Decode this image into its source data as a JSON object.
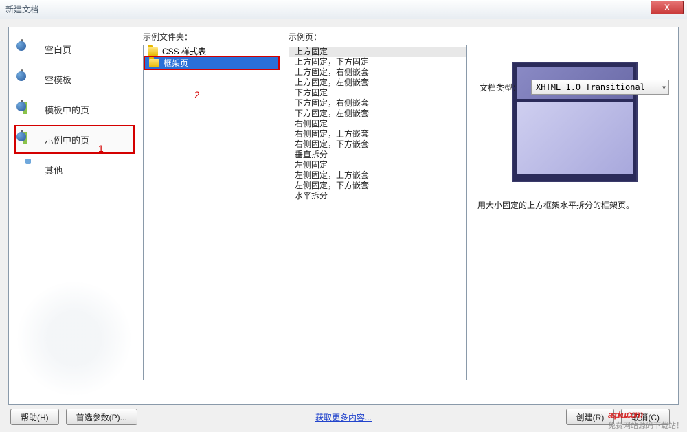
{
  "window": {
    "title": "新建文档",
    "close_label": "X"
  },
  "categories": [
    {
      "label": "空白页",
      "icon": "blank-page-icon"
    },
    {
      "label": "空模板",
      "icon": "blank-template-icon"
    },
    {
      "label": "模板中的页",
      "icon": "template-page-icon"
    },
    {
      "label": "示例中的页",
      "icon": "sample-page-icon"
    },
    {
      "label": "其他",
      "icon": "other-icon"
    }
  ],
  "annotations": {
    "one": "1",
    "two": "2"
  },
  "folder_column": {
    "label": "示例文件夹：",
    "items": [
      {
        "label": "CSS 样式表"
      },
      {
        "label": "框架页"
      }
    ]
  },
  "page_column": {
    "label": "示例页：",
    "items": [
      "上方固定",
      "上方固定，下方固定",
      "上方固定，右侧嵌套",
      "上方固定，左侧嵌套",
      "下方固定",
      "下方固定，右侧嵌套",
      "下方固定，左侧嵌套",
      "右侧固定",
      "右侧固定，上方嵌套",
      "右侧固定，下方嵌套",
      "垂直拆分",
      "左侧固定",
      "左侧固定，上方嵌套",
      "左侧固定，下方嵌套",
      "水平拆分"
    ]
  },
  "preview": {
    "description": "用大小固定的上方框架水平拆分的框架页。"
  },
  "doctype": {
    "label": "文档类型：",
    "value": "XHTML 1.0 Transitional"
  },
  "buttons": {
    "help": "帮助(H)",
    "prefs": "首选参数(P)...",
    "link": "获取更多内容...",
    "create": "创建(R)",
    "cancel": "取消(C)"
  },
  "watermark": {
    "logo": "aspku",
    "sub": ".com",
    "tag": "免费网站源码下载站！"
  }
}
